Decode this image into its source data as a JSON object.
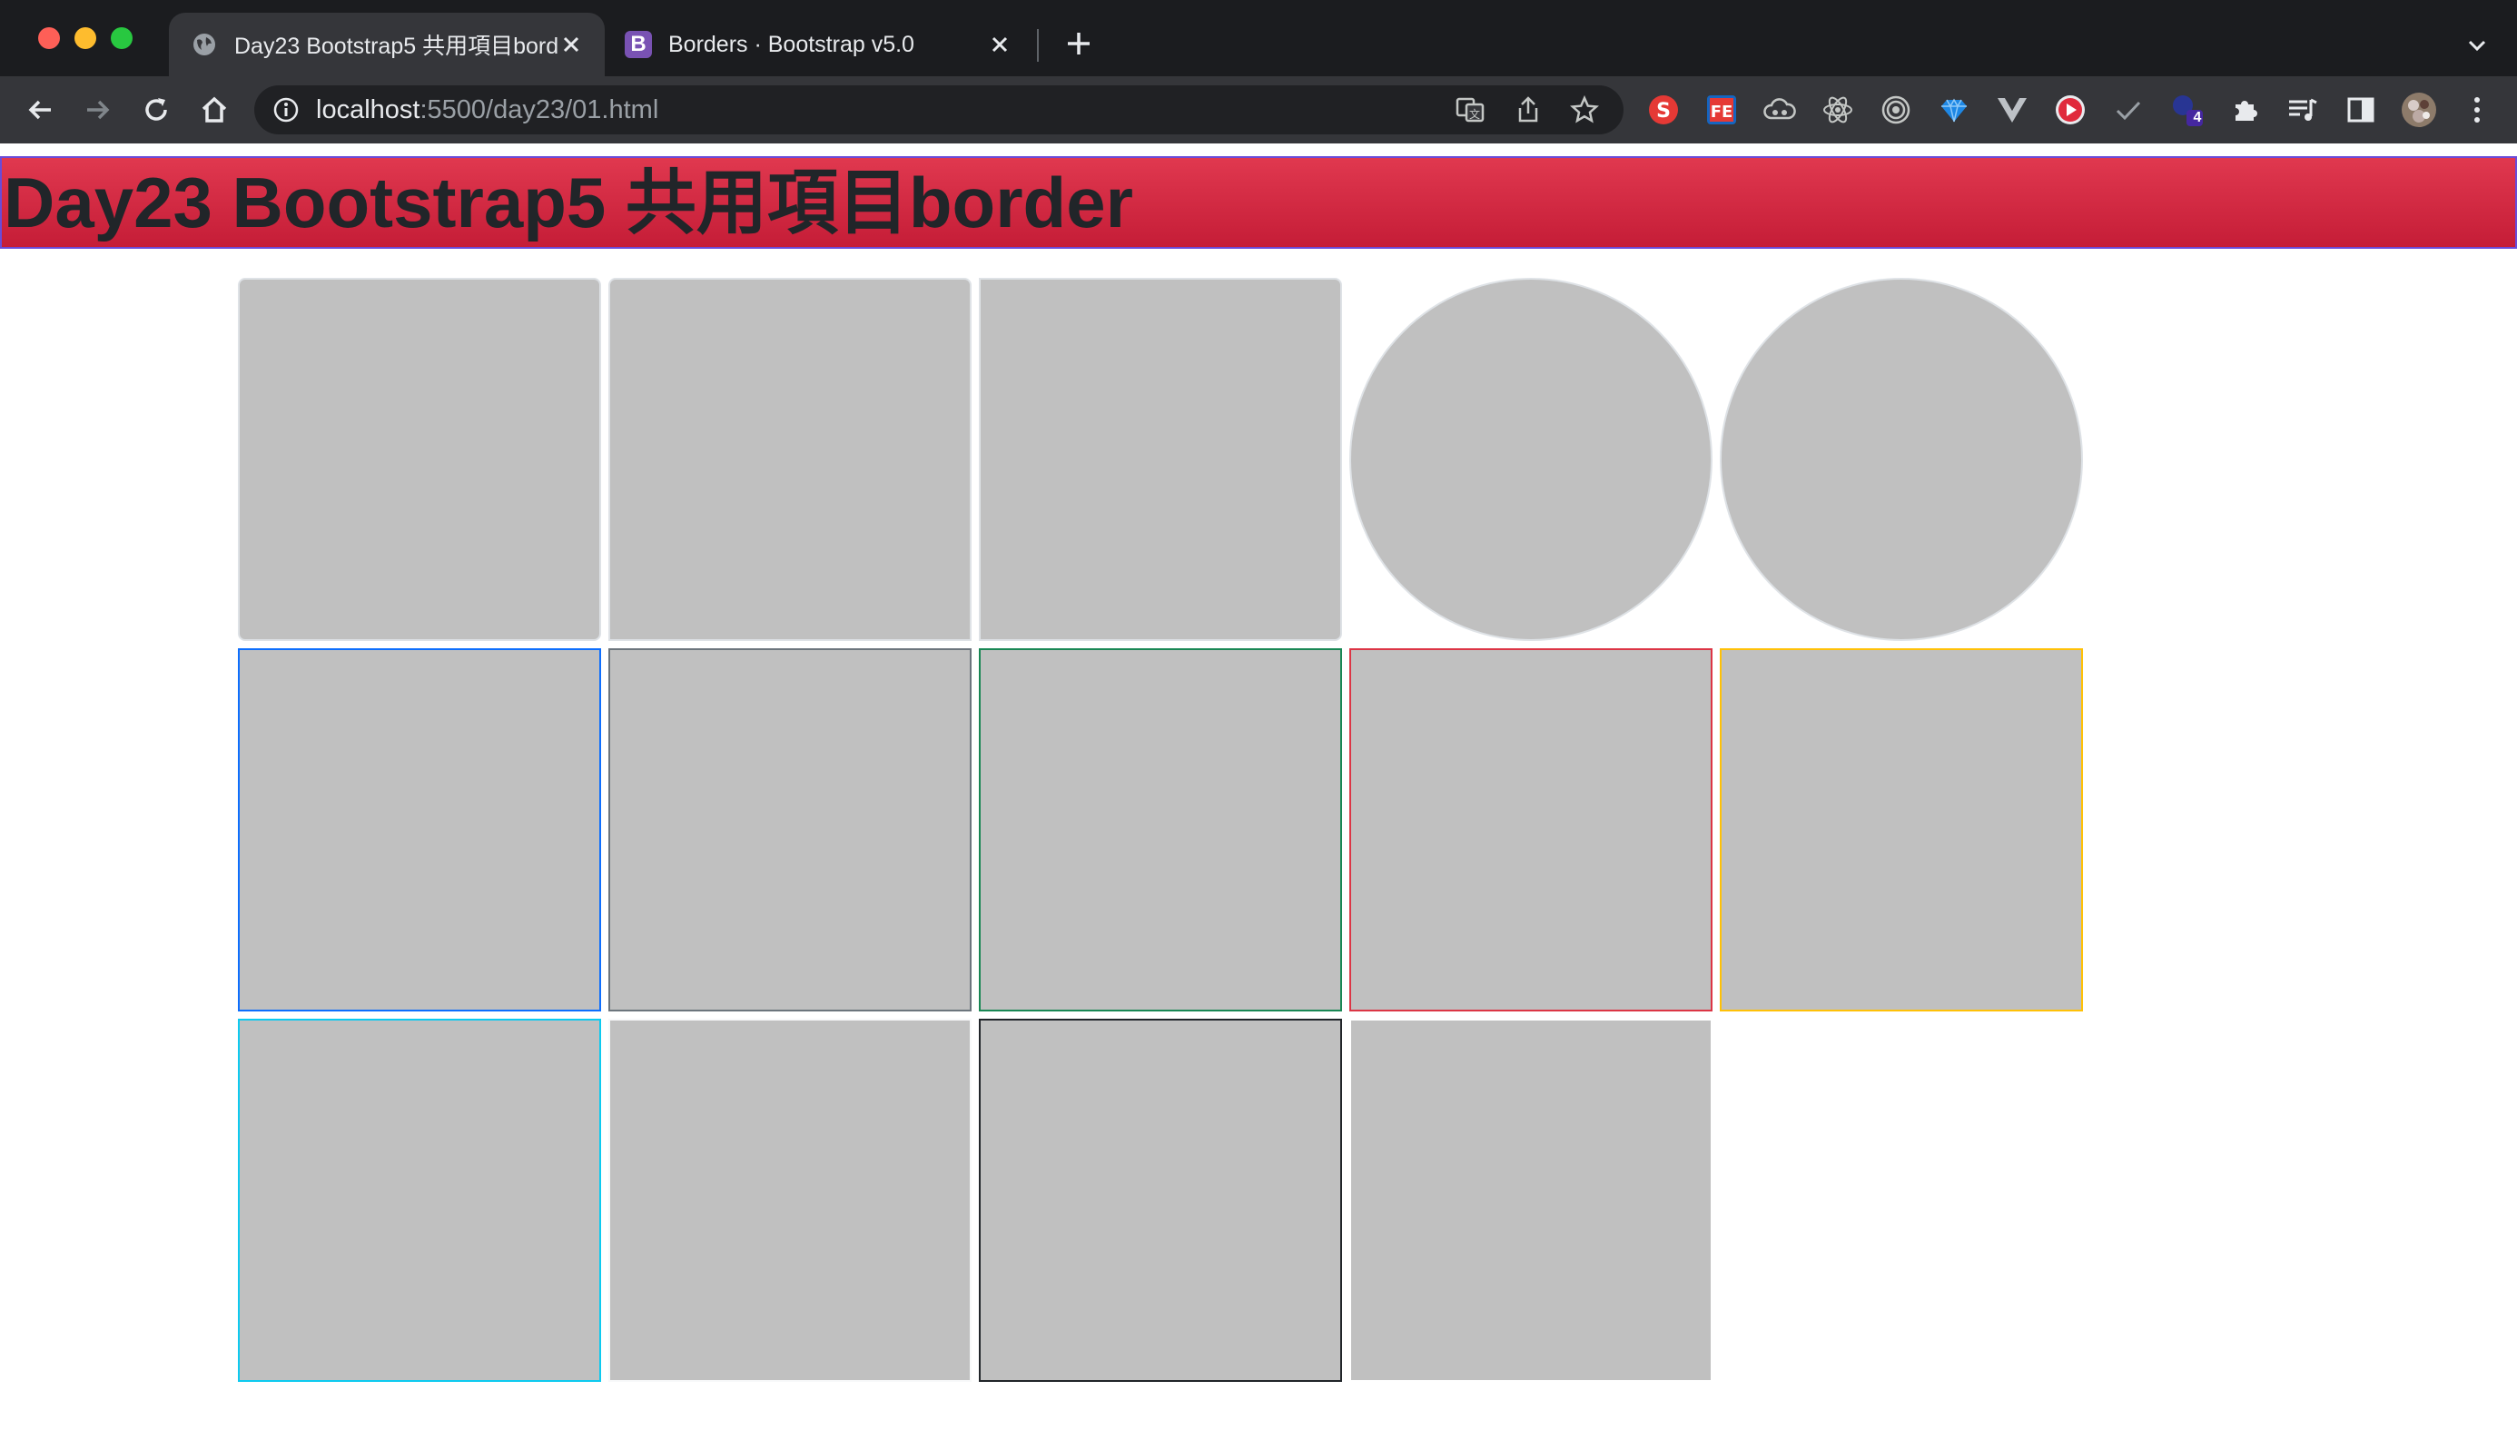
{
  "browser": {
    "tabs": [
      {
        "title": "Day23 Bootstrap5 共用項目border",
        "active": true,
        "favicon": "globe-icon"
      },
      {
        "title": "Borders · Bootstrap v5.0",
        "active": false,
        "favicon": "bootstrap-logo",
        "favicon_letter": "B",
        "favicon_color": "#7952b3"
      }
    ],
    "address": {
      "host": "localhost",
      "path": ":5500/day23/01.html"
    },
    "extensions": [
      "translate-icon",
      "share-icon",
      "bookmark-star-icon",
      "s-extension-icon",
      "fe-extension-icon",
      "cloud-extension-icon",
      "react-devtools-icon",
      "target-extension-icon",
      "gem-extension-icon",
      "vue-devtools-icon",
      "youtube-extension-icon",
      "check-extension-icon",
      "extension-badge-icon",
      "puzzle-icon",
      "reading-list-icon",
      "side-panel-icon",
      "profile-avatar",
      "menu-kebab-icon"
    ],
    "extension_badge": "4"
  },
  "page": {
    "heading": "Day23 Bootstrap5 共用項目border",
    "heading_bg": "#dc3545",
    "box_fill": "#c0c0c0",
    "boxes": [
      {
        "name": "box-rounded",
        "shape": "rounded",
        "border": "#dee2e6"
      },
      {
        "name": "box-rounded-top",
        "shape": "rounded-top",
        "border": "#dee2e6"
      },
      {
        "name": "box-rounded-end",
        "shape": "rounded-end",
        "border": "#dee2e6"
      },
      {
        "name": "box-rounded-circle-1",
        "shape": "circle",
        "border": "#dee2e6"
      },
      {
        "name": "box-rounded-circle-2",
        "shape": "circle",
        "border": "#dee2e6"
      },
      {
        "name": "box-border-primary",
        "shape": "square",
        "border": "#0d6efd"
      },
      {
        "name": "box-border-secondary",
        "shape": "square",
        "border": "#6c757d"
      },
      {
        "name": "box-border-success",
        "shape": "square",
        "border": "#198754"
      },
      {
        "name": "box-border-danger",
        "shape": "square",
        "border": "#dc3545"
      },
      {
        "name": "box-border-warning",
        "shape": "square",
        "border": "#ffc107"
      },
      {
        "name": "box-border-info",
        "shape": "square",
        "border": "#0dcaf0"
      },
      {
        "name": "box-border-light",
        "shape": "square",
        "border": "#f8f9fa"
      },
      {
        "name": "box-border-dark",
        "shape": "square",
        "border": "#212529"
      },
      {
        "name": "box-border-white",
        "shape": "square",
        "border": "#ffffff"
      }
    ]
  }
}
